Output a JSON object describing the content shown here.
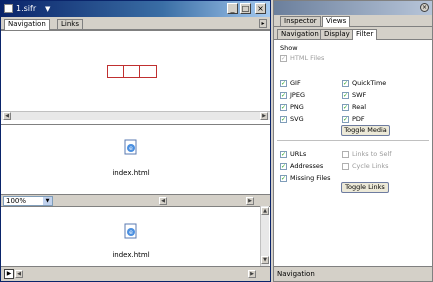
{
  "left_window": {
    "title": "1.sifr",
    "tabs": [
      "Navigation",
      "Links"
    ],
    "zoom_value": "100%",
    "files": [
      "index.html",
      "index.html"
    ]
  },
  "right_window": {
    "tabs": [
      "Inspector",
      "Views"
    ],
    "subtabs": [
      "Navigation",
      "Display",
      "Filter"
    ],
    "show_label": "Show",
    "html_files_label": "HTML Files",
    "types_left": [
      "GIF",
      "JPEG",
      "PNG",
      "SVG"
    ],
    "types_right": [
      "QuickTime",
      "SWF",
      "Real",
      "PDF"
    ],
    "toggle_media": "Toggle Media",
    "links_left": [
      "URLs",
      "Addresses",
      "Missing Files"
    ],
    "links_right": [
      "Links to Self",
      "Cycle Links"
    ],
    "toggle_links": "Toggle Links",
    "status": "Navigation"
  }
}
